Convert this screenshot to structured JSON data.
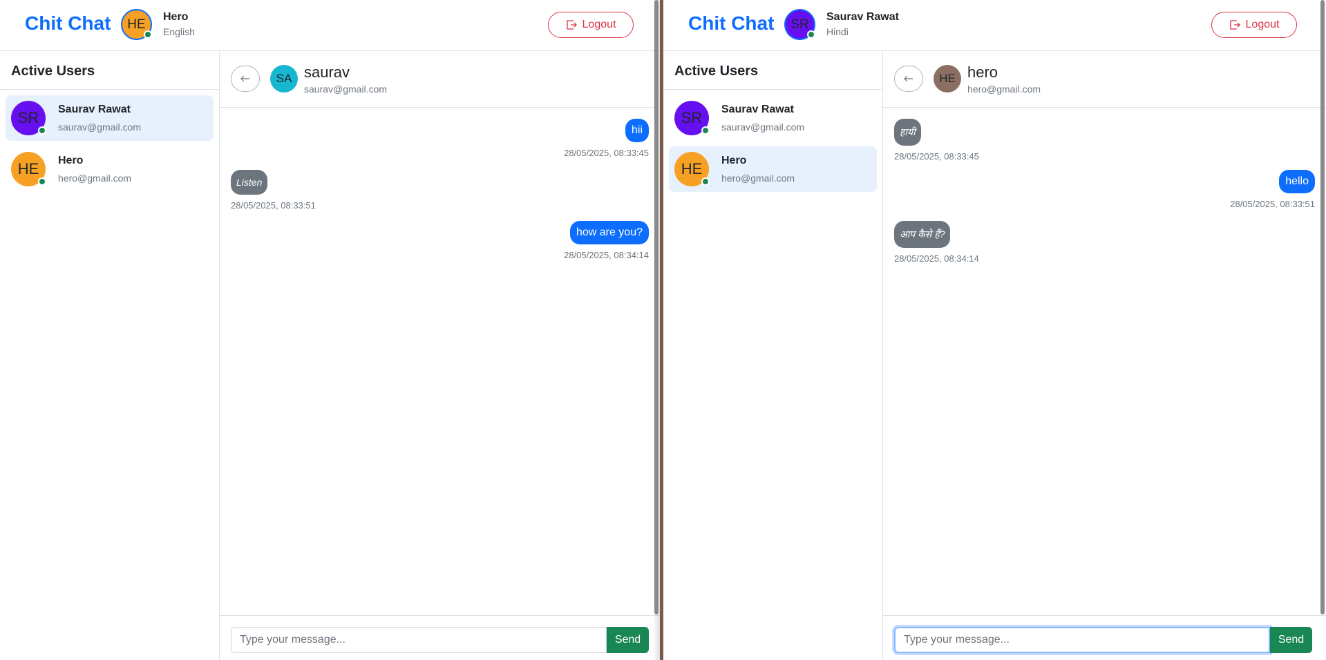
{
  "colors": {
    "primary": "#0d6efd",
    "danger": "#dc3545",
    "success": "#198754",
    "secondary": "#6c757d",
    "active_bg": "#e7f0fd"
  },
  "left_window": {
    "brand": "Chit Chat",
    "me": {
      "initials": "HE",
      "name": "Hero",
      "language": "English",
      "avatar_color": "#f7a124"
    },
    "logout_label": "Logout",
    "sidebar_title": "Active Users",
    "users": [
      {
        "initials": "SR",
        "name": "Saurav Rawat",
        "email": "saurav@gmail.com",
        "avatar_color": "#6610f2",
        "active": true
      },
      {
        "initials": "HE",
        "name": "Hero",
        "email": "hero@gmail.com",
        "avatar_color": "#f7a124",
        "active": false
      }
    ],
    "chat": {
      "back_icon": "arrow-left-icon",
      "contact": {
        "initials": "SA",
        "name": "saurav",
        "email": "saurav@gmail.com",
        "avatar_color": "#17b6d1"
      },
      "messages": [
        {
          "direction": "out",
          "text": "hii",
          "time": "28/05/2025, 08:33:45"
        },
        {
          "direction": "in",
          "text": "Listen",
          "time": "28/05/2025, 08:33:51"
        },
        {
          "direction": "out",
          "text": "how are you?",
          "time": "28/05/2025, 08:34:14"
        }
      ],
      "input_placeholder": "Type your message...",
      "input_value": "",
      "send_label": "Send"
    }
  },
  "right_window": {
    "brand": "Chit Chat",
    "me": {
      "initials": "SR",
      "name": "Saurav Rawat",
      "language": "Hindi",
      "avatar_color": "#6610f2"
    },
    "logout_label": "Logout",
    "sidebar_title": "Active Users",
    "users": [
      {
        "initials": "SR",
        "name": "Saurav Rawat",
        "email": "saurav@gmail.com",
        "avatar_color": "#6610f2",
        "active": false
      },
      {
        "initials": "HE",
        "name": "Hero",
        "email": "hero@gmail.com",
        "avatar_color": "#f7a124",
        "active": true
      }
    ],
    "chat": {
      "back_icon": "arrow-left-icon",
      "contact": {
        "initials": "HE",
        "name": "hero",
        "email": "hero@gmail.com",
        "avatar_color": "#8d6e63"
      },
      "messages": [
        {
          "direction": "in",
          "text": "हायी",
          "time": "28/05/2025, 08:33:45"
        },
        {
          "direction": "out",
          "text": "hello",
          "time": "28/05/2025, 08:33:51"
        },
        {
          "direction": "in",
          "text": "आप कैसे हैं?",
          "time": "28/05/2025, 08:34:14"
        }
      ],
      "input_placeholder": "Type your message...",
      "input_value": "",
      "send_label": "Send"
    }
  }
}
